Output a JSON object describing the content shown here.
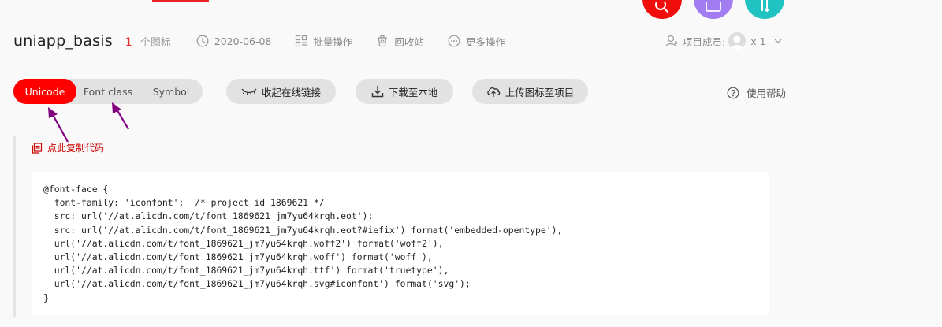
{
  "header": {
    "project_name": "uniapp_basis",
    "icon_count": "1",
    "icon_count_unit": "个图标",
    "date": "2020-06-08",
    "batch_ops": "批量操作",
    "recycle_bin": "回收站",
    "more_ops": "更多操作",
    "members_label": "项目成员:",
    "members_count": "x 1"
  },
  "fab_icons": [
    "search-icon",
    "add-icon",
    "swap-icon"
  ],
  "tabs": [
    "Unicode",
    "Font class",
    "Symbol"
  ],
  "active_tab": "Unicode",
  "actions": {
    "collapse_link": "收起在线链接",
    "download": "下载至本地",
    "upload": "上传图标至项目",
    "help": "使用帮助"
  },
  "copy_code": "点此复制代码",
  "code": "@font-face {\n  font-family: 'iconfont';  /* project id 1869621 */\n  src: url('//at.alicdn.com/t/font_1869621_jm7yu64krqh.eot');\n  src: url('//at.alicdn.com/t/font_1869621_jm7yu64krqh.eot?#iefix') format('embedded-opentype'),\n  url('//at.alicdn.com/t/font_1869621_jm7yu64krqh.woff2') format('woff2'),\n  url('//at.alicdn.com/t/font_1869621_jm7yu64krqh.woff') format('woff'),\n  url('//at.alicdn.com/t/font_1869621_jm7yu64krqh.ttf') format('truetype'),\n  url('//at.alicdn.com/t/font_1869621_jm7yu64krqh.svg#iconfont') format('svg');\n}",
  "colors": {
    "accent_red": "#ff0000",
    "fab_red": "#f20d0d",
    "fab_purple": "#a27df2",
    "fab_teal": "#20c2c2",
    "annotation_arrow": "#800080"
  }
}
